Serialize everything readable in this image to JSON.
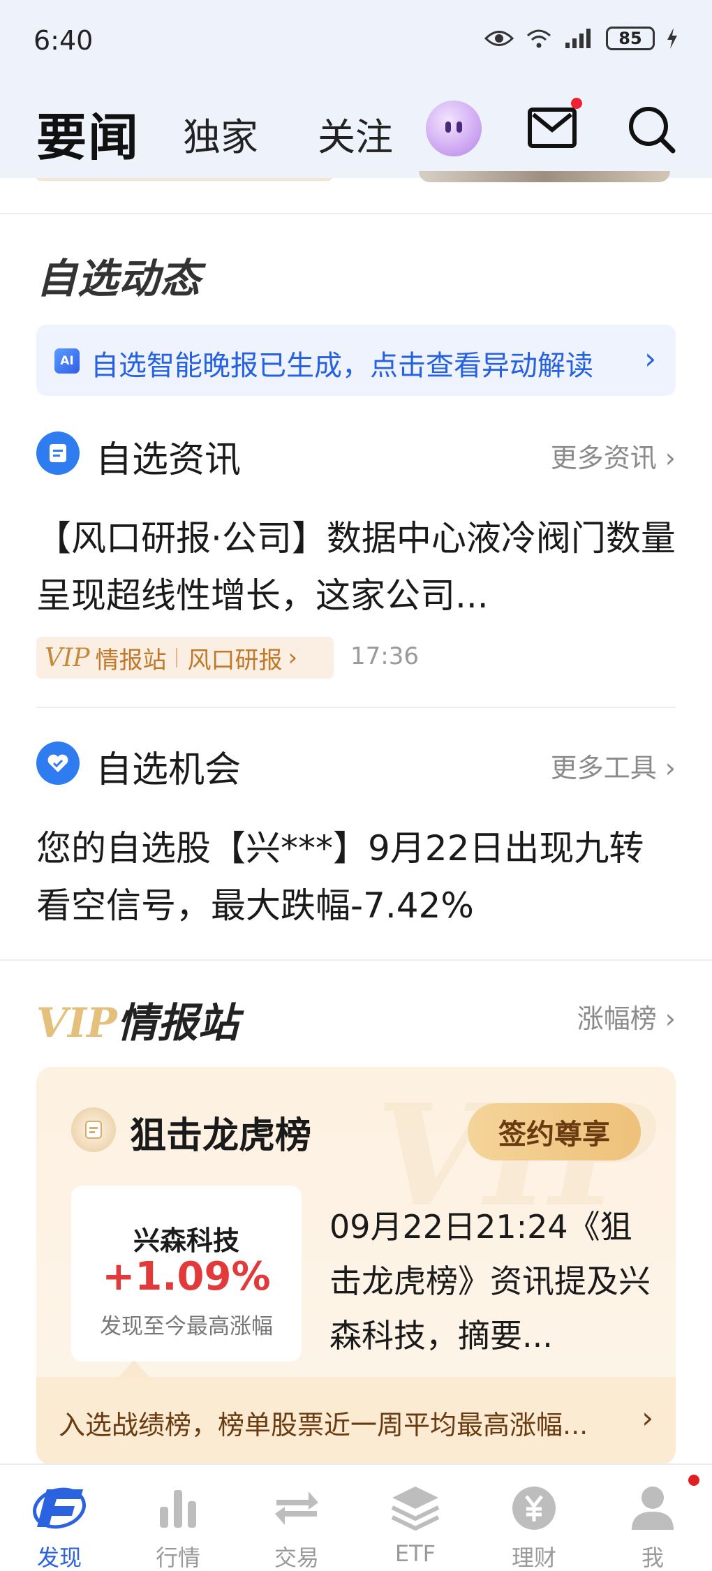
{
  "status_bar": {
    "time": "6:40",
    "battery": "85"
  },
  "nav": {
    "title": "要闻",
    "tabs": [
      {
        "label": "独家"
      },
      {
        "label": "关注"
      }
    ]
  },
  "watchlist": {
    "section_title": "自选动态",
    "ai_banner": {
      "badge": "AI",
      "text": "自选智能晚报已生成，点击查看异动解读"
    },
    "news": {
      "label": "自选资讯",
      "more": "更多资讯",
      "headline": "【风口研报·公司】数据中心液冷阀门数量呈现超线性增长，这家公司...",
      "tag_vip": "VIP",
      "tag_source": "情报站",
      "tag_column": "风口研报",
      "time": "17:36"
    },
    "opportunity": {
      "label": "自选机会",
      "more": "更多工具",
      "text": "您的自选股【兴***】9月22日出现九转看空信号，最大跌幅-7.42%"
    }
  },
  "vip_station": {
    "logo_vip": "VIP",
    "logo_word": "情报站",
    "more": "涨幅榜",
    "card": {
      "watermark": "VIP",
      "title": "狙击龙虎榜",
      "button": "签约尊享",
      "stock_name": "兴森科技",
      "stock_change": "+1.09%",
      "stock_desc": "发现至今最高涨幅",
      "news": "09月22日21:24《狙击龙虎榜》资讯提及兴森科技，摘要...",
      "footer": "入选战绩榜，榜单股票近一周平均最高涨幅..."
    }
  },
  "tabbar": {
    "items": [
      {
        "label": "发现",
        "icon": "discover-icon",
        "active": true
      },
      {
        "label": "行情",
        "icon": "market-chart-icon"
      },
      {
        "label": "交易",
        "icon": "trade-arrows-icon"
      },
      {
        "label": "ETF",
        "icon": "etf-layers-icon"
      },
      {
        "label": "理财",
        "icon": "wealth-yuan-icon"
      },
      {
        "label": "我",
        "icon": "profile-icon"
      }
    ]
  },
  "colors": {
    "accent": "#2a62e0",
    "rise": "#e23a3a",
    "vip_gold": "#e4c07c"
  }
}
